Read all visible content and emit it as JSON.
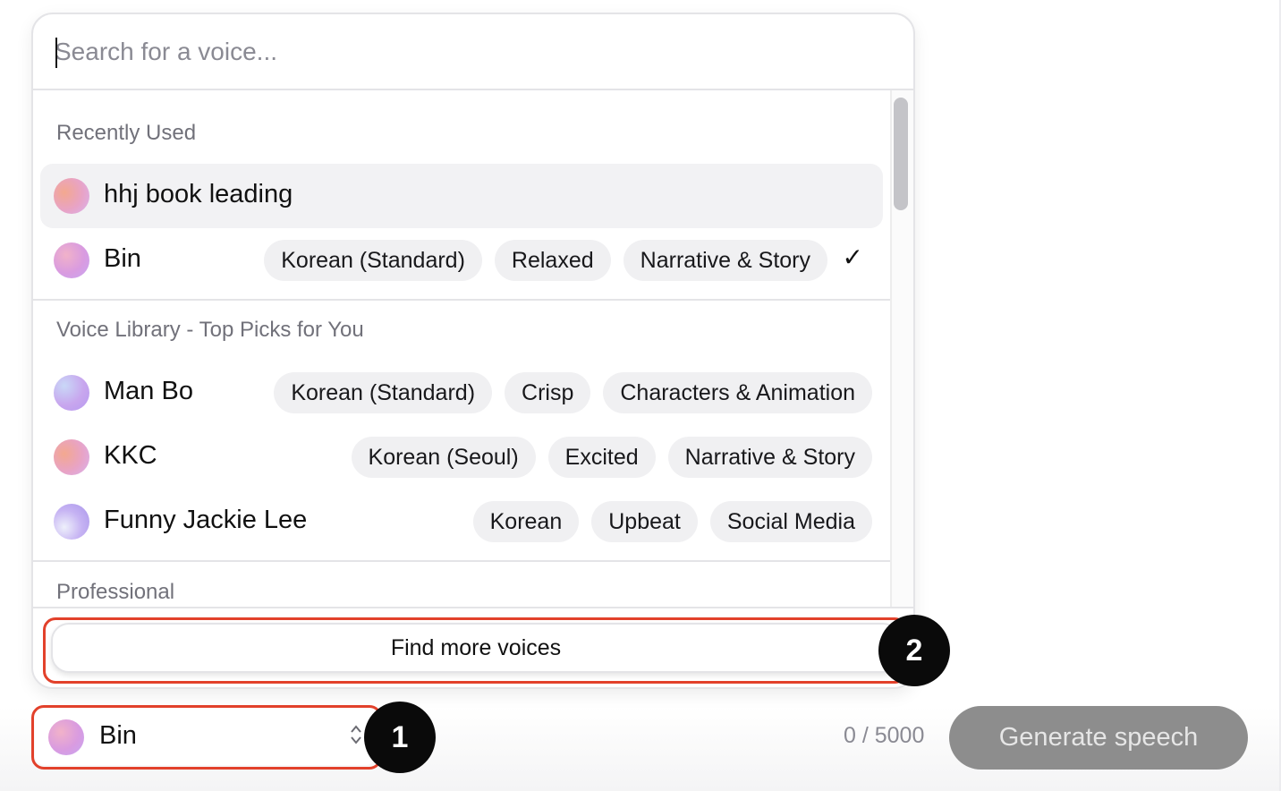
{
  "search": {
    "placeholder": "Search for a voice..."
  },
  "sections": {
    "recent_title": "Recently Used",
    "library_title": "Voice Library - Top Picks for You",
    "professional_title": "Professional"
  },
  "recent": [
    {
      "name": "hhj book leading",
      "tags": []
    },
    {
      "name": "Bin",
      "tags": [
        "Korean (Standard)",
        "Relaxed",
        "Narrative & Story"
      ],
      "selected_mark": "✓"
    }
  ],
  "library": [
    {
      "name": "Man Bo",
      "tags": [
        "Korean (Standard)",
        "Crisp",
        "Characters & Animation"
      ]
    },
    {
      "name": "KKC",
      "tags": [
        "Korean (Seoul)",
        "Excited",
        "Narrative & Story"
      ]
    },
    {
      "name": "Funny Jackie Lee",
      "tags": [
        "Korean",
        "Upbeat",
        "Social Media"
      ]
    }
  ],
  "find_more_label": "Find more voices",
  "selector": {
    "value": "Bin",
    "chevron": "⌃⌄"
  },
  "counter": "0 / 5000",
  "generate_label": "Generate speech",
  "annotations": {
    "badge_1": "1",
    "badge_2": "2",
    "highlight_color": "#e2412b"
  },
  "icons": {
    "check": "check-icon",
    "chevron": "chevron-up-down-icon"
  }
}
